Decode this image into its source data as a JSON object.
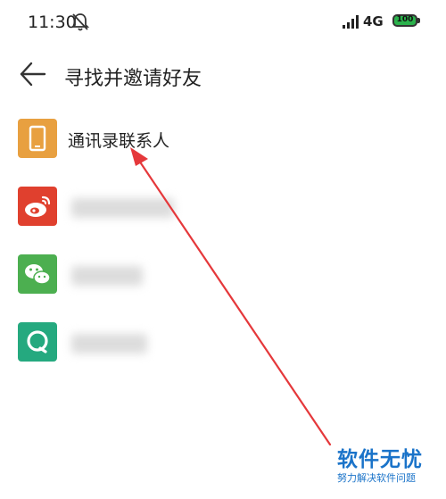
{
  "status_bar": {
    "time": "11:30",
    "network": "4G",
    "battery": "100"
  },
  "header": {
    "title": "寻找并邀请好友"
  },
  "list": {
    "items": [
      {
        "label": "通讯录联系人",
        "icon": "phone-icon",
        "color": "#e8a040"
      },
      {
        "label": "",
        "icon": "weibo-icon",
        "color": "#e0402e"
      },
      {
        "label": "",
        "icon": "wechat-icon",
        "color": "#4caf50"
      },
      {
        "label": "",
        "icon": "qq-icon",
        "color": "#25a97f"
      }
    ]
  },
  "watermark": {
    "title": "软件无忧",
    "subtitle": "努力解决软件问题"
  },
  "colors": {
    "annotation_arrow": "#e5383b",
    "watermark": "#1a73c9"
  }
}
